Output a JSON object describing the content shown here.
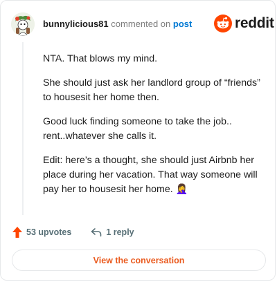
{
  "header": {
    "username": "bunnylicious81",
    "commented_on": "commented on",
    "post_link": "post"
  },
  "logo": {
    "wordmark": "reddit",
    "icon": "reddit-snoo-icon",
    "brand_color": "#ff4500"
  },
  "comment": {
    "paragraphs": [
      "NTA. That blows my mind.",
      "She should just ask her landlord group of “friends” to housesit her home then.",
      "Good luck finding someone to take the job.. rent..whatever she calls it.",
      "Edit: here’s a thought, she should just Airbnb her place during her vacation. That way someone will pay her to housesit her home. 🤦‍♀️"
    ]
  },
  "actions": {
    "upvotes": "53 upvotes",
    "replies": "1 reply"
  },
  "cta": {
    "label": "View the conversation",
    "color": "#ea5a1e"
  }
}
